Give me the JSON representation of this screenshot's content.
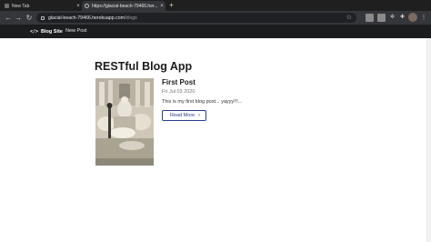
{
  "browser": {
    "tabs": [
      {
        "title": "New Tab",
        "active": false
      },
      {
        "title": "https://glacial-beach-79466.her...",
        "active": true
      }
    ],
    "close_glyph": "×",
    "new_tab_glyph": "+",
    "address": {
      "host": "glacial-beach-79466.herokuapp.com",
      "path": "/blogs"
    },
    "nav": {
      "back": "←",
      "forward": "→",
      "reload": "↻",
      "star": "☆",
      "menu": "⋮"
    },
    "extensions": [
      "extension-box",
      "extension-box",
      "puzzle-icon",
      "extensions-icon"
    ]
  },
  "site": {
    "brand": "Blog Site",
    "brand_icon": "</>",
    "nav_links": [
      "New Post"
    ]
  },
  "main": {
    "title": "RESTful Blog App",
    "posts": [
      {
        "title": "First Post",
        "date": "Fri Jul 03 2020",
        "body": "This is my first blog post... yayyy!!!...",
        "button_label": "Read More",
        "button_icon": "›",
        "image": "fountain-statue-photo"
      }
    ]
  }
}
